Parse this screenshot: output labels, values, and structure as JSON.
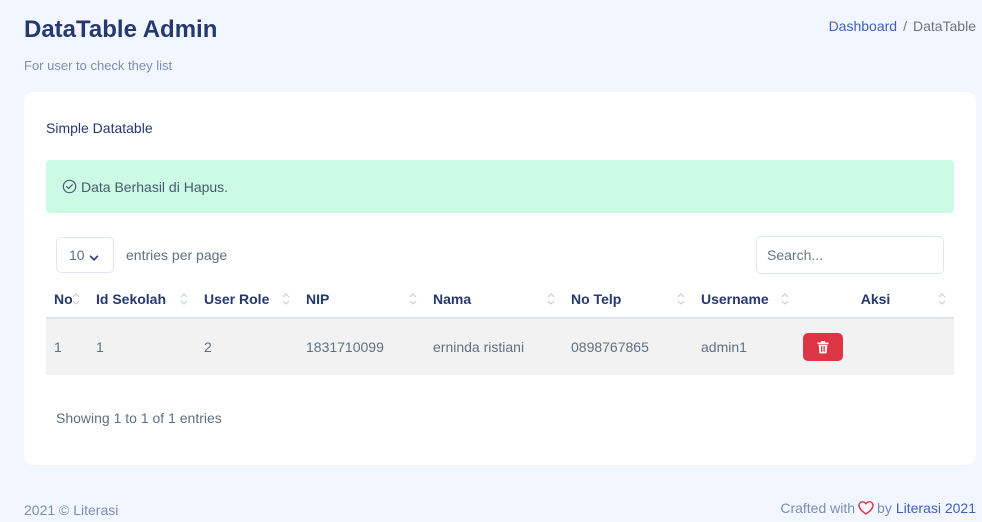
{
  "header": {
    "title": "DataTable Admin",
    "subtitle": "For user to check they list",
    "breadcrumb": {
      "link": "Dashboard",
      "separator": "/",
      "current": "DataTable"
    }
  },
  "card": {
    "title": "Simple Datatable",
    "alert": {
      "icon": "check-circle-icon",
      "message": "Data Berhasil di Hapus."
    },
    "per_page": {
      "value": "10",
      "label": "entries per page"
    },
    "search": {
      "placeholder": "Search..."
    },
    "table": {
      "columns": [
        "No",
        "Id Sekolah",
        "User Role",
        "NIP",
        "Nama",
        "No Telp",
        "Username",
        "Aksi"
      ],
      "rows": [
        {
          "no": "1",
          "id_sekolah": "1",
          "user_role": "2",
          "nip": "1831710099",
          "nama": "erninda ristiani",
          "no_telp": "0898767865",
          "username": "admin1",
          "action_icon": "trash-icon"
        }
      ]
    },
    "info": "Showing 1 to 1 of 1 entries"
  },
  "footer": {
    "left": "2021 © Literasi",
    "crafted": "Crafted with",
    "by": "by",
    "link": "Literasi 2021",
    "heart_icon": "heart-icon"
  },
  "colors": {
    "background": "#f2f7ff",
    "title": "#25396f",
    "primary": "#435ebe",
    "alert_bg": "#cbfbe5",
    "danger": "#dc3545"
  }
}
